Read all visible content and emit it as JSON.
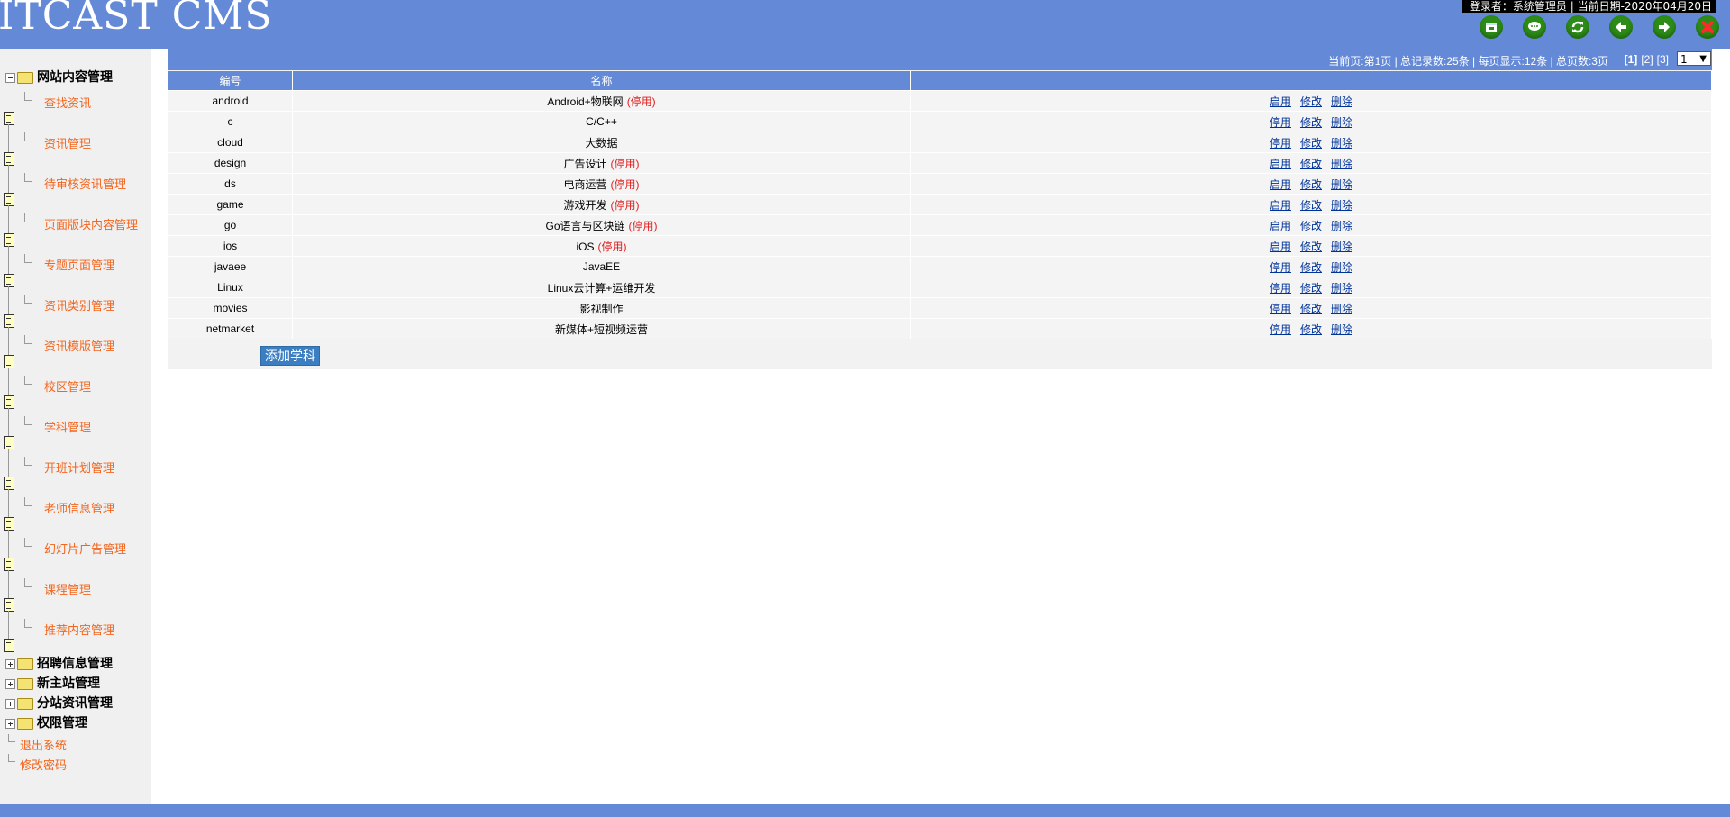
{
  "header": {
    "app_title": "ITCAST CMS",
    "login_info": "登录者：系统管理员 | 当前日期-2020年04月20日",
    "icons": [
      "window-icon",
      "chat-icon",
      "refresh-icon",
      "back-arrow-icon",
      "forward-arrow-icon",
      "close-icon"
    ]
  },
  "sidebar": {
    "groups": [
      {
        "label": "网站内容管理",
        "expanded": true,
        "children": [
          "查找资讯",
          "资讯管理",
          "待审核资讯管理",
          "页面版块内容管理",
          "专题页面管理",
          "资讯类别管理",
          "资讯模版管理",
          "校区管理",
          "学科管理",
          "开班计划管理",
          "老师信息管理",
          "幻灯片广告管理",
          "课程管理",
          "推荐内容管理"
        ]
      },
      {
        "label": "招聘信息管理",
        "expanded": false
      },
      {
        "label": "新主站管理",
        "expanded": false
      },
      {
        "label": "分站资讯管理",
        "expanded": false
      },
      {
        "label": "权限管理",
        "expanded": false
      }
    ],
    "links": [
      "退出系统",
      "修改密码"
    ]
  },
  "pager": {
    "summary": "当前页:第1页 | 总记录数:25条 | 每页显示:12条 | 总页数:3页",
    "pages": [
      "[1]",
      "[2]",
      "[3]"
    ],
    "selected_page": "1"
  },
  "table": {
    "headers": [
      "编号",
      "名称",
      ""
    ],
    "status_tag": "(停用)",
    "rows": [
      {
        "code": "android",
        "name": "Android+物联网",
        "stopped": true,
        "actions": [
          "启用",
          "修改",
          "删除"
        ]
      },
      {
        "code": "c",
        "name": "C/C++",
        "stopped": false,
        "actions": [
          "停用",
          "修改",
          "删除"
        ]
      },
      {
        "code": "cloud",
        "name": "大数据",
        "stopped": false,
        "actions": [
          "停用",
          "修改",
          "删除"
        ]
      },
      {
        "code": "design",
        "name": "广告设计",
        "stopped": true,
        "actions": [
          "启用",
          "修改",
          "删除"
        ]
      },
      {
        "code": "ds",
        "name": "电商运营",
        "stopped": true,
        "actions": [
          "启用",
          "修改",
          "删除"
        ]
      },
      {
        "code": "game",
        "name": "游戏开发",
        "stopped": true,
        "actions": [
          "启用",
          "修改",
          "删除"
        ]
      },
      {
        "code": "go",
        "name": "Go语言与区块链",
        "stopped": true,
        "actions": [
          "启用",
          "修改",
          "删除"
        ]
      },
      {
        "code": "ios",
        "name": "iOS",
        "stopped": true,
        "actions": [
          "启用",
          "修改",
          "删除"
        ]
      },
      {
        "code": "javaee",
        "name": "JavaEE",
        "stopped": false,
        "actions": [
          "停用",
          "修改",
          "删除"
        ]
      },
      {
        "code": "Linux",
        "name": "Linux云计算+运维开发",
        "stopped": false,
        "actions": [
          "停用",
          "修改",
          "删除"
        ]
      },
      {
        "code": "movies",
        "name": "影视制作",
        "stopped": false,
        "actions": [
          "停用",
          "修改",
          "删除"
        ]
      },
      {
        "code": "netmarket",
        "name": "新媒体+短视频运营",
        "stopped": false,
        "actions": [
          "停用",
          "修改",
          "删除"
        ]
      }
    ]
  },
  "add_button": "添加学科",
  "colors": {
    "brand": "#648ad7",
    "link_orange": "#f3651d",
    "stop_red": "#e02020",
    "button_blue": "#3b7ec2"
  }
}
